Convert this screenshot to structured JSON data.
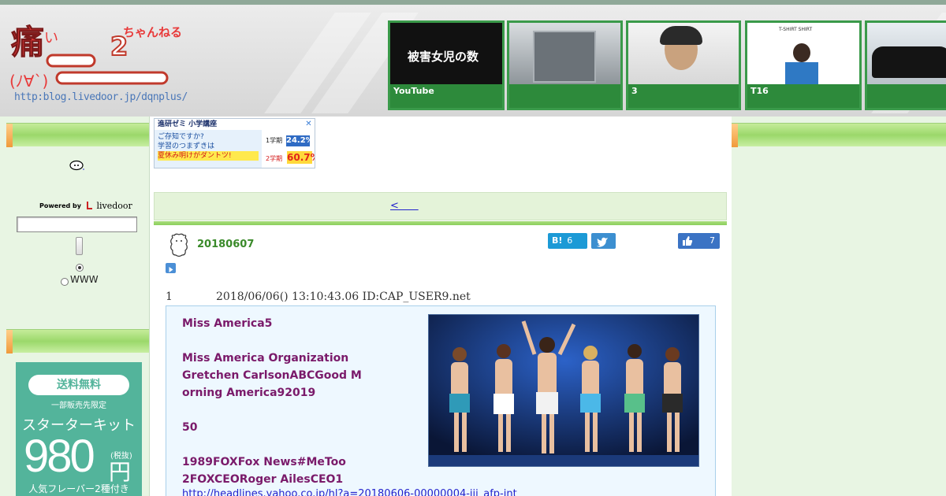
{
  "header": {
    "logo_url_text": "http:blog.livedoor.jp/dqnplus/",
    "logo_kanji": "痛",
    "logo_kana_small": "い",
    "logo_channel": "ちゃんねる",
    "logo_face": "(ﾉ∀`)",
    "thumbnails": [
      {
        "caption": "YouTube",
        "overlay_text": "被害女児の数"
      },
      {
        "caption": ""
      },
      {
        "caption": "3"
      },
      {
        "caption": "T16",
        "overlay_text": "T-SHIRT SHIRT"
      },
      {
        "caption": ""
      }
    ]
  },
  "left_sidebar": {
    "powered_by_label": "Powered by",
    "powered_brand": "livedoor",
    "search_placeholder": "",
    "radio_option_www": "WWW",
    "ad": {
      "pill": "送料無料",
      "limited": "一部販売先限定",
      "product": "スターターキット",
      "price": "980",
      "yen": "円",
      "tax": "(税抜)",
      "footer": "人気フレーバー2種付き"
    }
  },
  "top_ad": {
    "header": "進研ゼミ 小学講座",
    "line1": "ご存知ですか?",
    "line2": "学習のつまずきは",
    "line3": "夏休み明けがダントツ!",
    "term1": "1学期",
    "term1_value": "24.2%",
    "term2": "2学期",
    "term2_value": "60.7%"
  },
  "nav": {
    "prev_link": "<      "
  },
  "post": {
    "date": "20180607",
    "hatena_count": "6",
    "like_count": "7",
    "res_number": "1",
    "res_meta": "2018/06/06() 13:10:43.06 ID:CAP_USER9.net",
    "body_lines": [
      "Miss America5",
      "",
      "Miss America Organization",
      "Gretchen CarlsonABCGood M",
      "orning America92019",
      "",
      "50",
      "",
      "1989FOXFox News#MeToo",
      "2FOXCEORoger AilesCEO1"
    ],
    "link": "http://headlines.yahoo.co.jp/hl?a=20180606-00000004-jij_afp-int"
  },
  "colors": {
    "accent_green": "#3a8a2a",
    "nav_bg": "#e4f3d9",
    "body_text": "#7a1a6a",
    "link": "#2222cc"
  }
}
